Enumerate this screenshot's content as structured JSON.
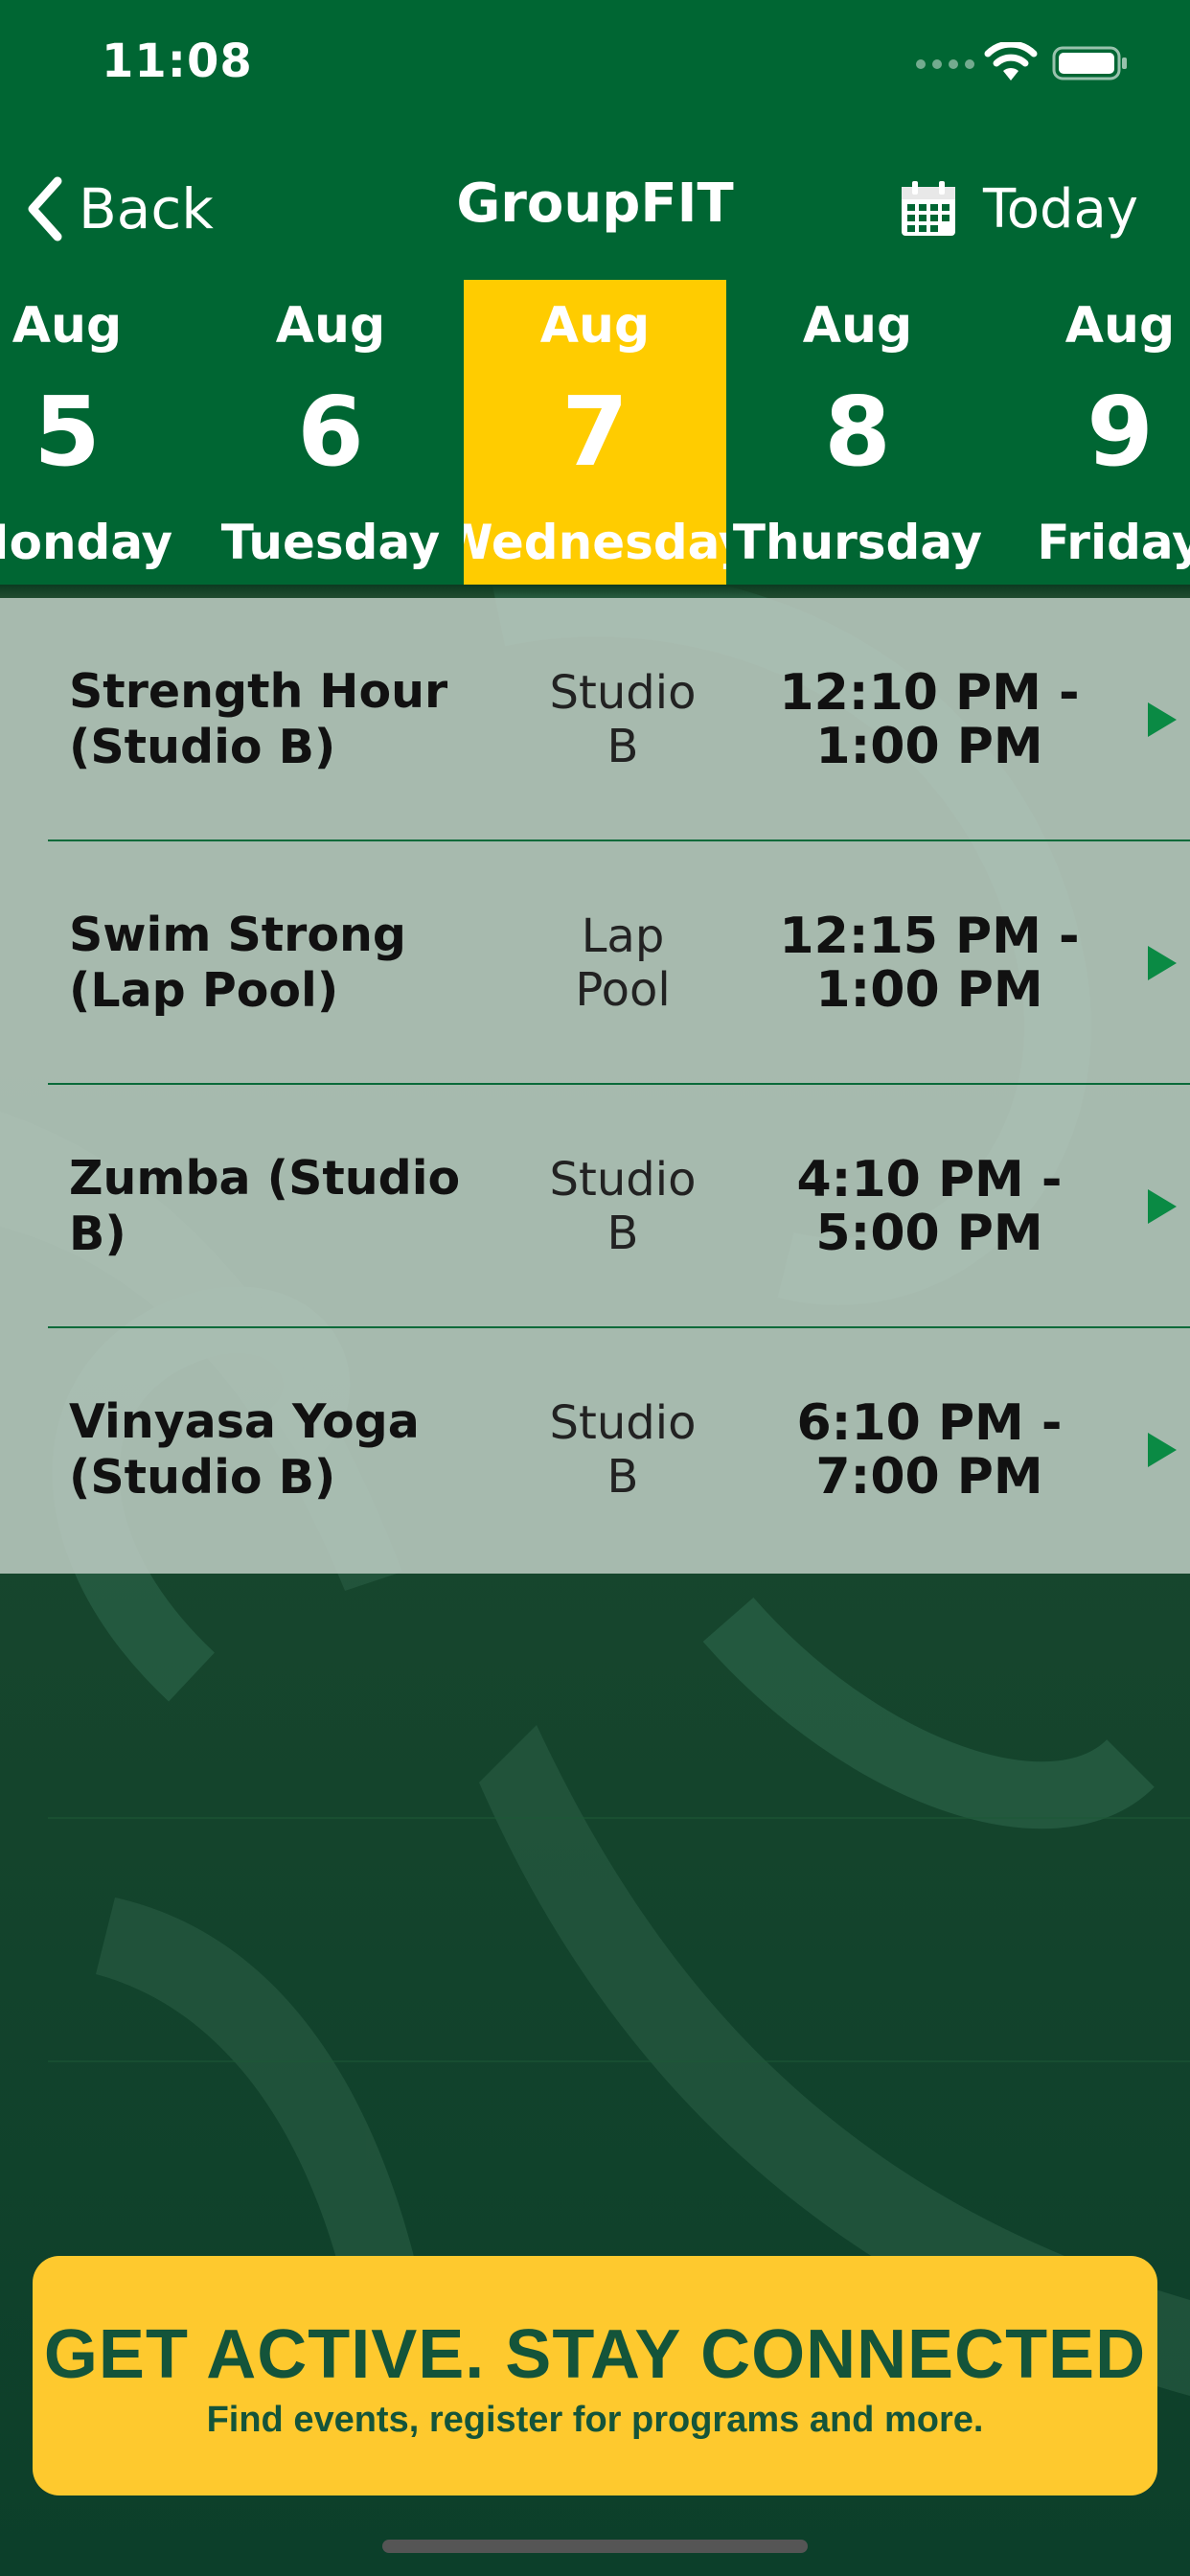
{
  "status_bar": {
    "time": "11:08",
    "icons": [
      "signal-dots-icon",
      "wifi-icon",
      "battery-icon"
    ]
  },
  "nav": {
    "back_label": "Back",
    "title": "GroupFIT",
    "today_label": "Today",
    "icons": [
      "chevron-left-icon",
      "calendar-icon"
    ]
  },
  "dates": [
    {
      "month": "Aug",
      "day": "5",
      "weekday": "Monday"
    },
    {
      "month": "Aug",
      "day": "6",
      "weekday": "Tuesday"
    },
    {
      "month": "Aug",
      "day": "7",
      "weekday": "Wednesday",
      "selected": true
    },
    {
      "month": "Aug",
      "day": "8",
      "weekday": "Thursday"
    },
    {
      "month": "Aug",
      "day": "9",
      "weekday": "Friday"
    }
  ],
  "classes": [
    {
      "name": "Strength Hour (Studio B)",
      "room_line1": "Studio",
      "room_line2": "B",
      "time_line1": "12:10 PM -",
      "time_line2": "1:00 PM"
    },
    {
      "name": "Swim Strong (Lap Pool)",
      "room_line1": "Lap",
      "room_line2": "Pool",
      "time_line1": "12:15 PM -",
      "time_line2": "1:00 PM"
    },
    {
      "name": "Zumba (Studio B)",
      "room_line1": "Studio",
      "room_line2": "B",
      "time_line1": "4:10 PM -",
      "time_line2": "5:00 PM"
    },
    {
      "name": "Vinyasa Yoga (Studio B)",
      "room_line1": "Studio",
      "room_line2": "B",
      "time_line1": "6:10 PM -",
      "time_line2": "7:00 PM"
    }
  ],
  "banner": {
    "title": "GET ACTIVE.  STAY CONNECTED",
    "subtitle": "Find events, register for programs and more."
  },
  "colors": {
    "primary_green": "#006633",
    "selected_yellow": "#ffcc00",
    "banner_yellow": "#fec92e",
    "banner_text": "#14543a",
    "arrow_green": "#0a8a44"
  }
}
